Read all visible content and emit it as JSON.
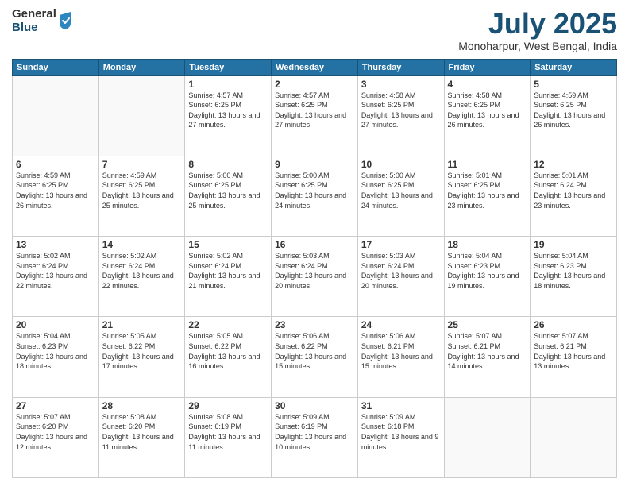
{
  "logo": {
    "general": "General",
    "blue": "Blue"
  },
  "title": "July 2025",
  "subtitle": "Monoharpur, West Bengal, India",
  "days_header": [
    "Sunday",
    "Monday",
    "Tuesday",
    "Wednesday",
    "Thursday",
    "Friday",
    "Saturday"
  ],
  "weeks": [
    [
      {
        "num": "",
        "info": ""
      },
      {
        "num": "",
        "info": ""
      },
      {
        "num": "1",
        "info": "Sunrise: 4:57 AM\nSunset: 6:25 PM\nDaylight: 13 hours and 27 minutes."
      },
      {
        "num": "2",
        "info": "Sunrise: 4:57 AM\nSunset: 6:25 PM\nDaylight: 13 hours and 27 minutes."
      },
      {
        "num": "3",
        "info": "Sunrise: 4:58 AM\nSunset: 6:25 PM\nDaylight: 13 hours and 27 minutes."
      },
      {
        "num": "4",
        "info": "Sunrise: 4:58 AM\nSunset: 6:25 PM\nDaylight: 13 hours and 26 minutes."
      },
      {
        "num": "5",
        "info": "Sunrise: 4:59 AM\nSunset: 6:25 PM\nDaylight: 13 hours and 26 minutes."
      }
    ],
    [
      {
        "num": "6",
        "info": "Sunrise: 4:59 AM\nSunset: 6:25 PM\nDaylight: 13 hours and 26 minutes."
      },
      {
        "num": "7",
        "info": "Sunrise: 4:59 AM\nSunset: 6:25 PM\nDaylight: 13 hours and 25 minutes."
      },
      {
        "num": "8",
        "info": "Sunrise: 5:00 AM\nSunset: 6:25 PM\nDaylight: 13 hours and 25 minutes."
      },
      {
        "num": "9",
        "info": "Sunrise: 5:00 AM\nSunset: 6:25 PM\nDaylight: 13 hours and 24 minutes."
      },
      {
        "num": "10",
        "info": "Sunrise: 5:00 AM\nSunset: 6:25 PM\nDaylight: 13 hours and 24 minutes."
      },
      {
        "num": "11",
        "info": "Sunrise: 5:01 AM\nSunset: 6:25 PM\nDaylight: 13 hours and 23 minutes."
      },
      {
        "num": "12",
        "info": "Sunrise: 5:01 AM\nSunset: 6:24 PM\nDaylight: 13 hours and 23 minutes."
      }
    ],
    [
      {
        "num": "13",
        "info": "Sunrise: 5:02 AM\nSunset: 6:24 PM\nDaylight: 13 hours and 22 minutes."
      },
      {
        "num": "14",
        "info": "Sunrise: 5:02 AM\nSunset: 6:24 PM\nDaylight: 13 hours and 22 minutes."
      },
      {
        "num": "15",
        "info": "Sunrise: 5:02 AM\nSunset: 6:24 PM\nDaylight: 13 hours and 21 minutes."
      },
      {
        "num": "16",
        "info": "Sunrise: 5:03 AM\nSunset: 6:24 PM\nDaylight: 13 hours and 20 minutes."
      },
      {
        "num": "17",
        "info": "Sunrise: 5:03 AM\nSunset: 6:24 PM\nDaylight: 13 hours and 20 minutes."
      },
      {
        "num": "18",
        "info": "Sunrise: 5:04 AM\nSunset: 6:23 PM\nDaylight: 13 hours and 19 minutes."
      },
      {
        "num": "19",
        "info": "Sunrise: 5:04 AM\nSunset: 6:23 PM\nDaylight: 13 hours and 18 minutes."
      }
    ],
    [
      {
        "num": "20",
        "info": "Sunrise: 5:04 AM\nSunset: 6:23 PM\nDaylight: 13 hours and 18 minutes."
      },
      {
        "num": "21",
        "info": "Sunrise: 5:05 AM\nSunset: 6:22 PM\nDaylight: 13 hours and 17 minutes."
      },
      {
        "num": "22",
        "info": "Sunrise: 5:05 AM\nSunset: 6:22 PM\nDaylight: 13 hours and 16 minutes."
      },
      {
        "num": "23",
        "info": "Sunrise: 5:06 AM\nSunset: 6:22 PM\nDaylight: 13 hours and 15 minutes."
      },
      {
        "num": "24",
        "info": "Sunrise: 5:06 AM\nSunset: 6:21 PM\nDaylight: 13 hours and 15 minutes."
      },
      {
        "num": "25",
        "info": "Sunrise: 5:07 AM\nSunset: 6:21 PM\nDaylight: 13 hours and 14 minutes."
      },
      {
        "num": "26",
        "info": "Sunrise: 5:07 AM\nSunset: 6:21 PM\nDaylight: 13 hours and 13 minutes."
      }
    ],
    [
      {
        "num": "27",
        "info": "Sunrise: 5:07 AM\nSunset: 6:20 PM\nDaylight: 13 hours and 12 minutes."
      },
      {
        "num": "28",
        "info": "Sunrise: 5:08 AM\nSunset: 6:20 PM\nDaylight: 13 hours and 11 minutes."
      },
      {
        "num": "29",
        "info": "Sunrise: 5:08 AM\nSunset: 6:19 PM\nDaylight: 13 hours and 11 minutes."
      },
      {
        "num": "30",
        "info": "Sunrise: 5:09 AM\nSunset: 6:19 PM\nDaylight: 13 hours and 10 minutes."
      },
      {
        "num": "31",
        "info": "Sunrise: 5:09 AM\nSunset: 6:18 PM\nDaylight: 13 hours and 9 minutes."
      },
      {
        "num": "",
        "info": ""
      },
      {
        "num": "",
        "info": ""
      }
    ]
  ]
}
